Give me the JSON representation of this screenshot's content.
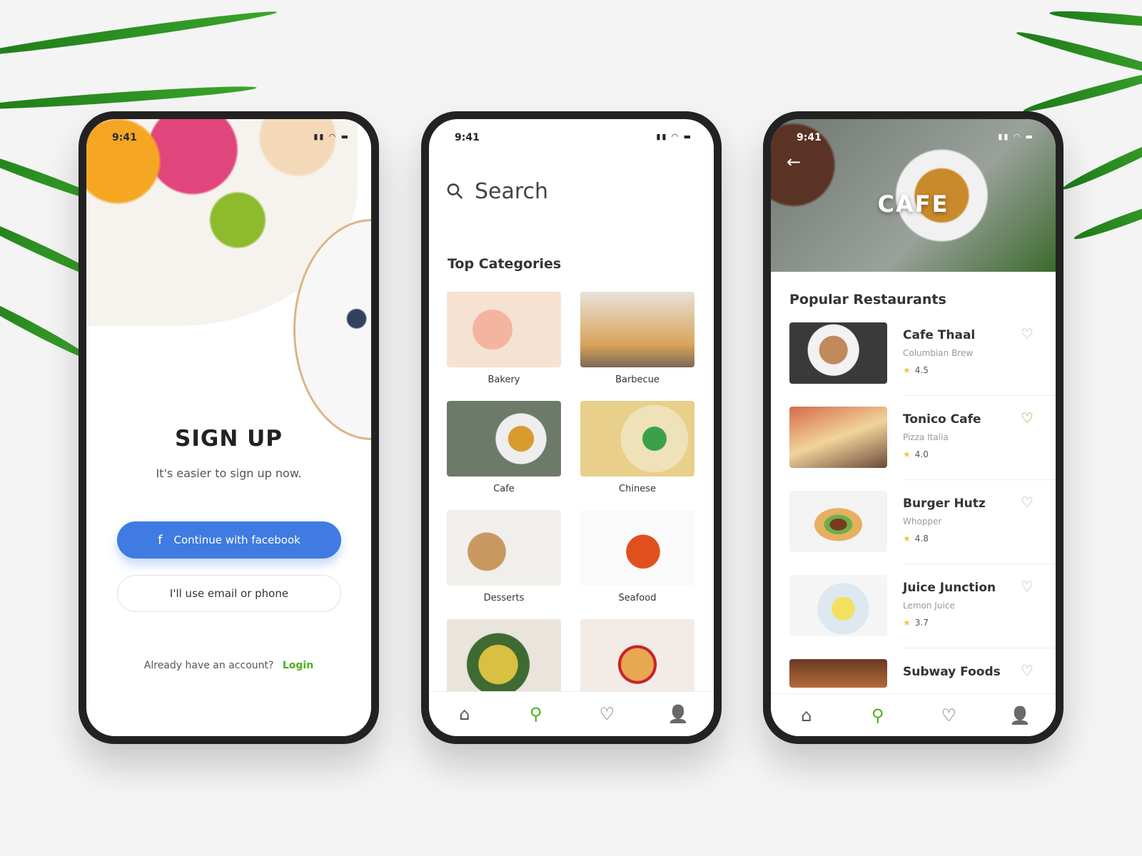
{
  "colors": {
    "accent": "#4caf1e",
    "facebook": "#3f7be0",
    "star": "#f7c23c"
  },
  "status": {
    "time": "9:41",
    "icons": "signal-icon wifi-icon battery-icon"
  },
  "signup": {
    "title": "SIGN UP",
    "subtitle": "It's easier to sign up now.",
    "facebook_icon": "f",
    "facebook_label": "Continue with facebook",
    "email_label": "I'll use email or phone",
    "already": "Already have an account?",
    "login": "Login"
  },
  "search": {
    "placeholder": "Search",
    "section_title": "Top Categories",
    "categories": [
      {
        "label": "Bakery"
      },
      {
        "label": "Barbecue"
      },
      {
        "label": "Cafe"
      },
      {
        "label": "Chinese"
      },
      {
        "label": "Desserts"
      },
      {
        "label": "Seafood"
      },
      {
        "label": ""
      },
      {
        "label": ""
      }
    ]
  },
  "cafe": {
    "header_title": "CAFE",
    "section_title": "Popular Restaurants",
    "restaurants": [
      {
        "name": "Cafe Thaal",
        "sub": "Columbian Brew",
        "rating": "4.5",
        "favorited": false
      },
      {
        "name": "Tonico Cafe",
        "sub": "Pizza Italia",
        "rating": "4.0",
        "favorited": true
      },
      {
        "name": "Burger Hutz",
        "sub": "Whopper",
        "rating": "4.8",
        "favorited": false
      },
      {
        "name": "Juice Junction",
        "sub": "Lemon Juice",
        "rating": "3.7",
        "favorited": false
      },
      {
        "name": "Subway Foods",
        "sub": "",
        "rating": "",
        "favorited": false
      }
    ]
  },
  "nav": {
    "home": "⌂",
    "search": "⚲",
    "favorites": "♡",
    "profile": "👤"
  }
}
